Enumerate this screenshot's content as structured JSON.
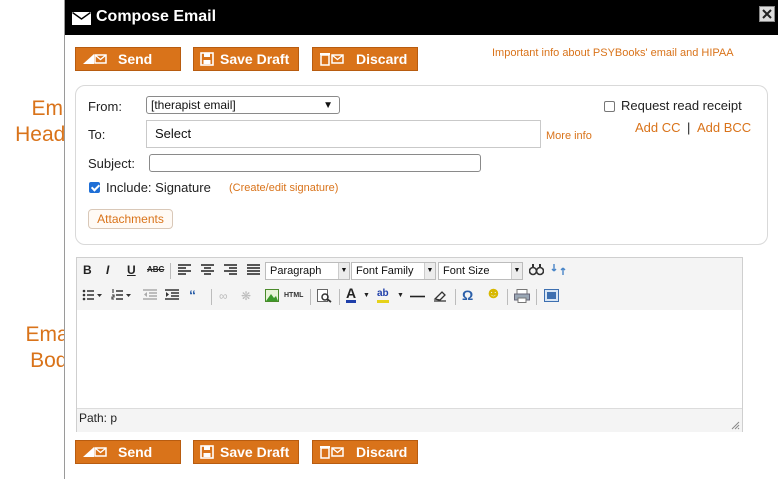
{
  "side_labels": {
    "header": "Email Header",
    "body": "Email Body"
  },
  "dialog": {
    "title": "Compose Email",
    "close_label": "X"
  },
  "buttons": {
    "send": "Send",
    "save_draft": "Save Draft",
    "discard": "Discard"
  },
  "info_link": "Important info about PSYBooks' email and HIPAA",
  "header": {
    "from_label": "From:",
    "from_value": "[therapist email]",
    "to_label": "To:",
    "to_value": "Select",
    "more_info": "More info",
    "subject_label": "Subject:",
    "subject_value": "",
    "include_label": "Include: Signature",
    "include_checked": true,
    "signature_link": "(Create/edit signature)",
    "request_receipt": "Request read receipt",
    "request_receipt_checked": false,
    "add_cc": "Add CC",
    "separator": "|",
    "add_bcc": "Add BCC",
    "attachments": "Attachments"
  },
  "editor": {
    "format_options": {
      "paragraph": "Paragraph",
      "font_family": "Font Family",
      "font_size": "Font Size"
    },
    "path": "Path: p"
  },
  "colors": {
    "accent": "#d9731a",
    "titlebar": "#000000"
  }
}
